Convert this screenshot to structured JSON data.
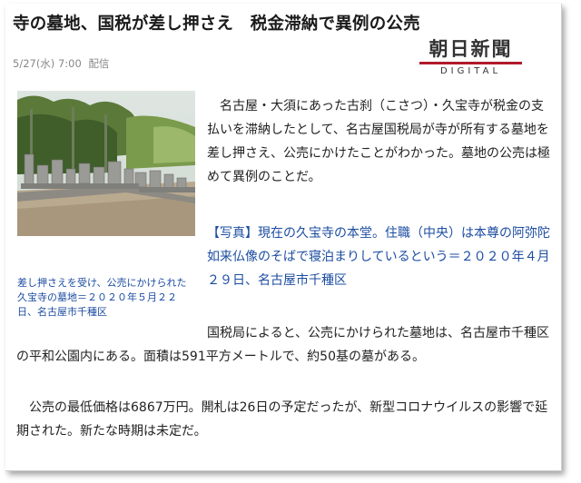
{
  "article": {
    "headline": "寺の墓地、国税が差し押さえ　税金滞納で異例の公売",
    "date": "5/27(水) 7:00",
    "meta_label": "配信",
    "source_logo": {
      "main": "朝日新聞",
      "sub": "DIGITAL",
      "rule_color": "#b11a2b"
    },
    "photo": {
      "icon": "cemetery-photo",
      "caption": "差し押さえを受け、公売にかけられた久宝寺の墓地＝２０２０年５月２２日、名古屋市千種区"
    },
    "paragraph_1": "名古屋・大須にあった古刹（こさつ）・久宝寺が税金の支払いを滞納したとして、名古屋国税局が寺が所有する墓地を差し押さえ、公売にかけたことがわかった。墓地の公売は極めて異例のことだ。",
    "photo_note": "【写真】現在の久宝寺の本堂。住職（中央）は本尊の阿弥陀如来仏像のそばで寝泊まりしているという＝２０２０年４月２９日、名古屋市千種区",
    "paragraph_2": "国税局によると、公売にかけられた墓地は、名古屋市千種区の平和公園内にある。面積は591平方メートルで、約50基の墓がある。",
    "paragraph_3": "公売の最低価格は6867万円。開札は26日の予定だったが、新型コロナウイルスの影響で延期された。新たな時期は未定だ。"
  },
  "colors": {
    "link_blue": "#1c4da1",
    "text": "#222222",
    "meta_gray": "#888888"
  }
}
